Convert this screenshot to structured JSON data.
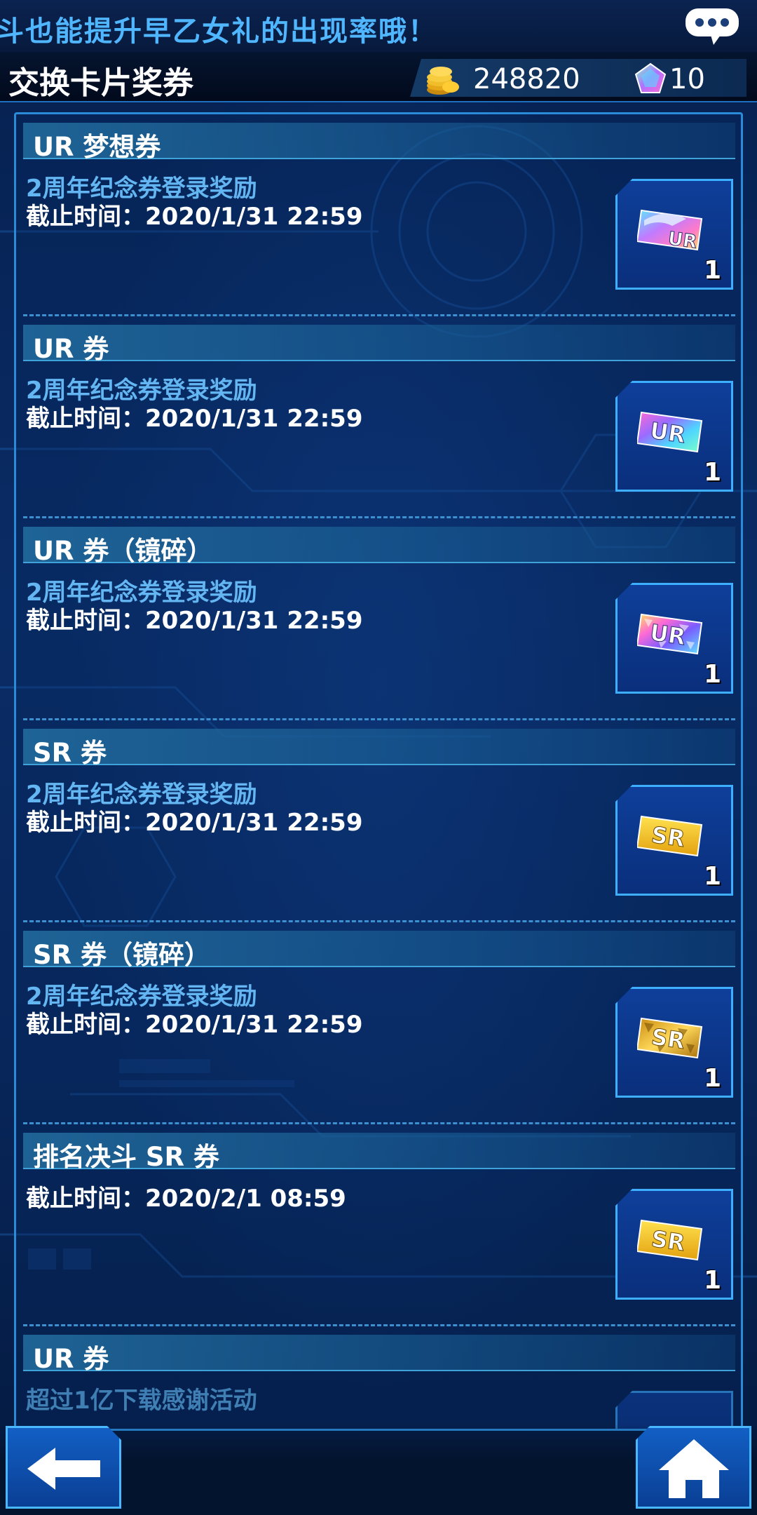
{
  "ticker": {
    "text": "斗也能提升早乙女礼的出现率哦！"
  },
  "header": {
    "title": "交换卡片奖券",
    "coins": "248820",
    "gems": "10"
  },
  "entries": [
    {
      "title": "UR 梦想券",
      "source": "2周年纪念券登录奖励",
      "deadline": "截止时间：2020/1/31 22:59",
      "ticket_label": "UR",
      "ticket_style": "ur-dream",
      "count": "1"
    },
    {
      "title": "UR 券",
      "source": "2周年纪念券登录奖励",
      "deadline": "截止时间：2020/1/31 22:59",
      "ticket_label": "UR",
      "ticket_style": "ur",
      "count": "1"
    },
    {
      "title": "UR 券（镜碎）",
      "source": "2周年纪念券登录奖励",
      "deadline": "截止时间：2020/1/31 22:59",
      "ticket_label": "UR",
      "ticket_style": "ur-shatter",
      "count": "1"
    },
    {
      "title": "SR 券",
      "source": "2周年纪念券登录奖励",
      "deadline": "截止时间：2020/1/31 22:59",
      "ticket_label": "SR",
      "ticket_style": "sr",
      "count": "1"
    },
    {
      "title": "SR 券（镜碎）",
      "source": "2周年纪念券登录奖励",
      "deadline": "截止时间：2020/1/31 22:59",
      "ticket_label": "SR",
      "ticket_style": "sr-shatter",
      "count": "1"
    },
    {
      "title": "排名决斗 SR 券",
      "source": "",
      "deadline": "截止时间：2020/2/1 08:59",
      "ticket_label": "SR",
      "ticket_style": "sr",
      "count": "1"
    },
    {
      "title": "UR 券",
      "source": "超过1亿下载感谢活动",
      "deadline": "",
      "ticket_label": "",
      "ticket_style": "",
      "count": ""
    }
  ],
  "colors": {
    "accent": "#3eaeff",
    "source_text": "#63b6f2",
    "ur_gradient": [
      "#4fe0ff",
      "#b45cff",
      "#ff5cc8",
      "#ffe14f"
    ],
    "sr_gold": "#f2c01f"
  },
  "icons": {
    "chat": "chat-bubble-icon",
    "coins": "coin-stack-icon",
    "gem": "gem-icon",
    "back": "back-arrow-icon",
    "home": "home-icon"
  }
}
